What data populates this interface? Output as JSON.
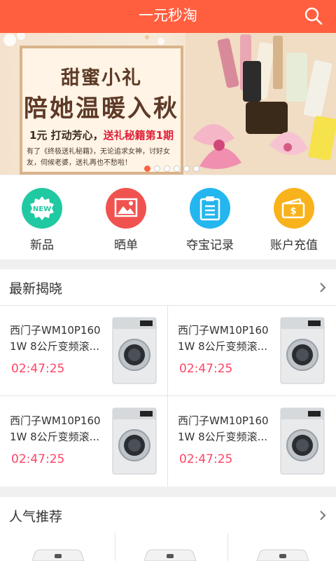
{
  "app": {
    "title": "一元秒淘"
  },
  "banner": {
    "title1": "甜蜜小礼",
    "title2": "陪她温暖入秋",
    "line_pre": "1元 打动芳心，",
    "line_red": "送礼秘籍第1期",
    "desc": "有了《终极送礼秘籍》，无论追求女神，讨好女友，伺候老婆，送礼再也不愁啦！",
    "slides": 6,
    "active": 0
  },
  "quick_links": [
    {
      "label": "新品",
      "icon": "new-badge-icon",
      "color": "#20c9a2",
      "badge": "NEW"
    },
    {
      "label": "晒单",
      "icon": "picture-icon",
      "color": "#f0534f"
    },
    {
      "label": "夺宝记录",
      "icon": "clipboard-icon",
      "color": "#24b6ef"
    },
    {
      "label": "账户充值",
      "icon": "wallet-icon",
      "color": "#f8b21b"
    }
  ],
  "latest": {
    "title": "最新揭晓",
    "items": [
      {
        "name": "西门子WM10P160\n1W 8公斤变频滚...",
        "time": "02:47:25",
        "icon": "washing-machine-icon"
      },
      {
        "name": "西门子WM10P160\n1W 8公斤变频滚...",
        "time": "02:47:25",
        "icon": "washing-machine-icon"
      },
      {
        "name": "西门子WM10P160\n1W 8公斤变频滚...",
        "time": "02:47:25",
        "icon": "washing-machine-icon"
      },
      {
        "name": "西门子WM10P160\n1W 8公斤变频滚...",
        "time": "02:47:25",
        "icon": "washing-machine-icon"
      }
    ]
  },
  "popular": {
    "title": "人气推荐"
  },
  "colors": {
    "header": "#ff5f3f",
    "timer": "#ff4466"
  }
}
